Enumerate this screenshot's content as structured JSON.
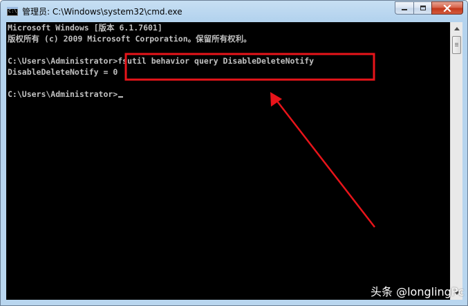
{
  "window": {
    "title": "管理员: C:\\Windows\\system32\\cmd.exe",
    "app_icon_text": "C:\\",
    "buttons": [
      "minimize",
      "maximize",
      "close"
    ]
  },
  "console": {
    "lines": [
      "Microsoft Windows [版本 6.1.7601]",
      "版权所有 (c) 2009 Microsoft Corporation。保留所有权利。",
      "",
      "C:\\Users\\Administrator>fsutil behavior query DisableDeleteNotify",
      "DisableDeleteNotify = 0",
      "",
      "C:\\Users\\Administrator>"
    ],
    "text_color": "#c0c0c0",
    "background_color": "#000000"
  },
  "annotation": {
    "highlight_color": "#e8141a",
    "highlights": [
      "fsutil behavior query DisableDeleteNotify",
      "0"
    ]
  },
  "watermark": "头条 @longlingPc"
}
